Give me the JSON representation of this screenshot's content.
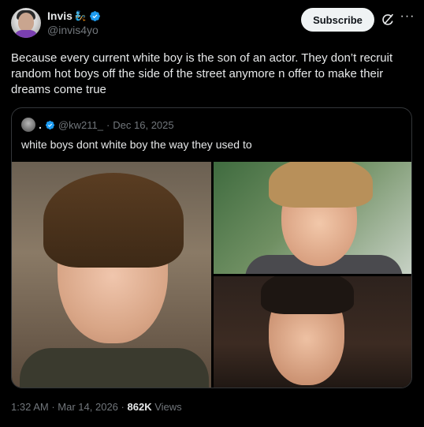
{
  "author": {
    "display_name": "Invis",
    "emoji": "🧞",
    "handle": "@invis4yo"
  },
  "actions": {
    "subscribe_label": "Subscribe",
    "more_label": "···"
  },
  "post": {
    "text": "Because every current white boy is the son of an actor. They don’t recruit random hot boys off the side of the street anymore n offer to make their dreams come true"
  },
  "quote": {
    "display_name": ".",
    "handle": "@kw211_",
    "separator": "·",
    "date": "Dec 16, 2025",
    "text": "white boys dont white boy the way they used to"
  },
  "meta": {
    "time": "1:32 AM",
    "separator": "·",
    "date": "Mar 14, 2026",
    "views_count": "862K",
    "views_label": "Views"
  },
  "colors": {
    "background": "#000000",
    "text": "#e7e9ea",
    "muted": "#71767b",
    "verified": "#1d9bf0",
    "border": "#333639"
  }
}
